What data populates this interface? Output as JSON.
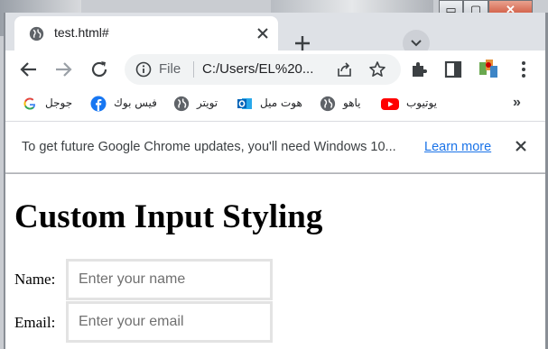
{
  "window": {
    "minimize_label": "▭",
    "maximize_label": "▢",
    "close_label": "✕"
  },
  "tab": {
    "title": "test.html#",
    "favicon": "globe-icon",
    "close_icon": "close-icon"
  },
  "tabstrip": {
    "new_tab_label": "+",
    "tab_search_icon": "chevron-down-icon"
  },
  "toolbar": {
    "back_icon": "back-arrow-icon",
    "forward_icon": "forward-arrow-icon",
    "reload_icon": "reload-icon",
    "omnibox": {
      "scheme_label": "File",
      "url": "C:/Users/EL%20...",
      "info_icon": "info-icon",
      "share_icon": "share-icon",
      "bookmark_icon": "star-icon"
    },
    "extensions_icon": "puzzle-icon",
    "side_panel_icon": "side-panel-icon",
    "profile_icon": "avatar",
    "menu_icon": "kebab-menu-icon"
  },
  "bookmarks": {
    "items": [
      {
        "label": "جوجل",
        "icon": "google-icon"
      },
      {
        "label": "فيس بوك",
        "icon": "facebook-icon"
      },
      {
        "label": "تويتر",
        "icon": "globe-icon"
      },
      {
        "label": "هوت ميل",
        "icon": "outlook-icon"
      },
      {
        "label": "ياهو",
        "icon": "globe-icon"
      },
      {
        "label": "يوتيوب",
        "icon": "youtube-icon"
      }
    ],
    "more_label": "»"
  },
  "infobar": {
    "message": "To get future Google Chrome updates, you'll need Windows 10...",
    "link": "Learn more",
    "close_label": "✕"
  },
  "page": {
    "title": "Custom Input Styling",
    "fields": [
      {
        "label": "Name:",
        "placeholder": "Enter your name"
      },
      {
        "label": "Email:",
        "placeholder": "Enter your email"
      }
    ]
  },
  "colors": {
    "tabstrip_bg": "#dee1e6",
    "link": "#1a73e8",
    "input_border": "#e3e3e3"
  }
}
